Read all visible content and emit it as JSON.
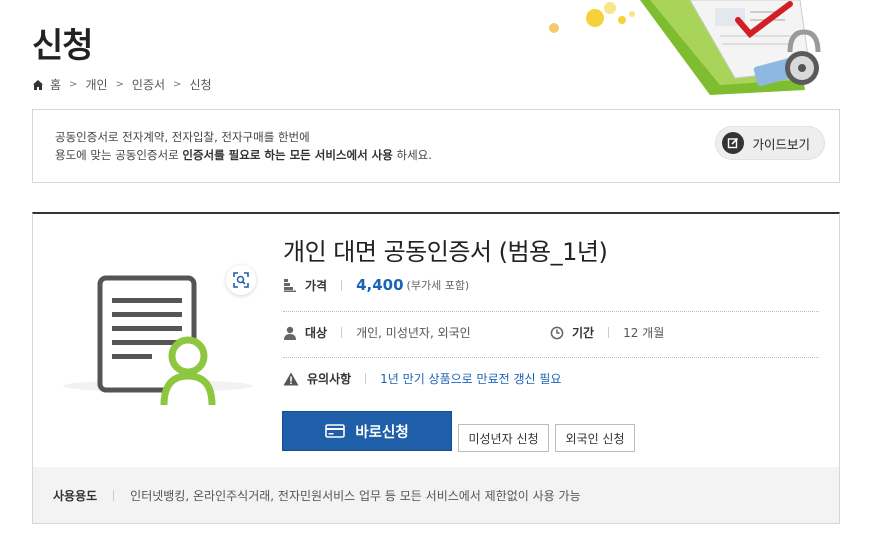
{
  "page": {
    "title": "신청"
  },
  "breadcrumb": [
    "홈",
    "개인",
    "인증서",
    "신청"
  ],
  "info": {
    "line1": "공동인증서로 전자계약, 전자입찰, 전자구매를 한번에",
    "line2_prefix": "용도에 맞는 공동인증서로 ",
    "line2_bold1": "인증서를 필요로 하는 모든 서비스에서 사용",
    "line2_suffix": " 하세요.",
    "guide_label": "가이드보기"
  },
  "product": {
    "title": "개인 대면 공동인증서 (범용_1년)",
    "price_label": "가격",
    "price_value": "4,400",
    "price_note": "(부가세 포함)",
    "target_label": "대상",
    "target_value": "개인, 미성년자, 외국인",
    "period_label": "기간",
    "period_value": "12 개월",
    "notice_label": "유의사항",
    "notice_value": "1년 만기 상품으로 만료전 갱신 필요",
    "apply_label": "바로신청",
    "minor_label": "미성년자 신청",
    "foreigner_label": "외국인 신청",
    "usage_label": "사용용도",
    "usage_value": "인터넷뱅킹, 온라인주식거래, 전자민원서비스 업무 등 모든 서비스에서 제한없이 사용 가능"
  },
  "colors": {
    "accent": "#1f5ea8",
    "price": "#1c63b7",
    "person_green": "#8dc63f"
  }
}
